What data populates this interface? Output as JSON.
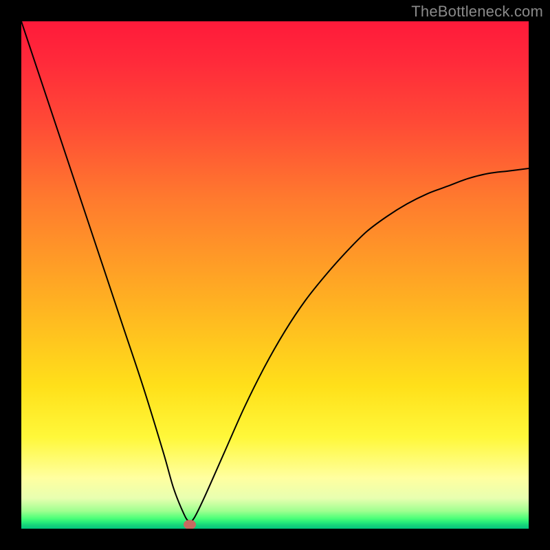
{
  "watermark": "TheBottleneck.com",
  "chart_data": {
    "type": "line",
    "title": "",
    "xlabel": "",
    "ylabel": "",
    "xlim": [
      0,
      100
    ],
    "ylim": [
      0,
      100
    ],
    "grid": false,
    "legend": false,
    "description": "Bottleneck curve on a vertical gradient from red (high, top) to green (low, bottom). The black curve drops steeply from the top-left corner to a minimum near x≈33 (value ≈0) then rises with decreasing slope toward the right edge (≈70 at x=100). A small red rounded marker is placed at the curve's minimum.",
    "series": [
      {
        "name": "bottleneck-curve",
        "x": [
          0,
          4,
          8,
          12,
          16,
          20,
          24,
          28,
          30,
          32,
          33,
          34,
          36,
          40,
          44,
          48,
          52,
          56,
          60,
          64,
          68,
          72,
          76,
          80,
          84,
          88,
          92,
          96,
          100
        ],
        "y": [
          100,
          88,
          76,
          64,
          52,
          40,
          28,
          15,
          8,
          3,
          1.5,
          2,
          6,
          15,
          24,
          32,
          39,
          45,
          50,
          54.5,
          58.5,
          61.5,
          64,
          66,
          67.5,
          69,
          70,
          70.5,
          71
        ]
      }
    ],
    "marker": {
      "x": 33.2,
      "y": 0.8,
      "color": "#c76a60",
      "rx": 9,
      "ry": 7
    },
    "curve_color": "#000000",
    "curve_width": 2
  },
  "plot_geometry": {
    "inner_left": 31,
    "inner_top": 31,
    "inner_size": 738
  }
}
